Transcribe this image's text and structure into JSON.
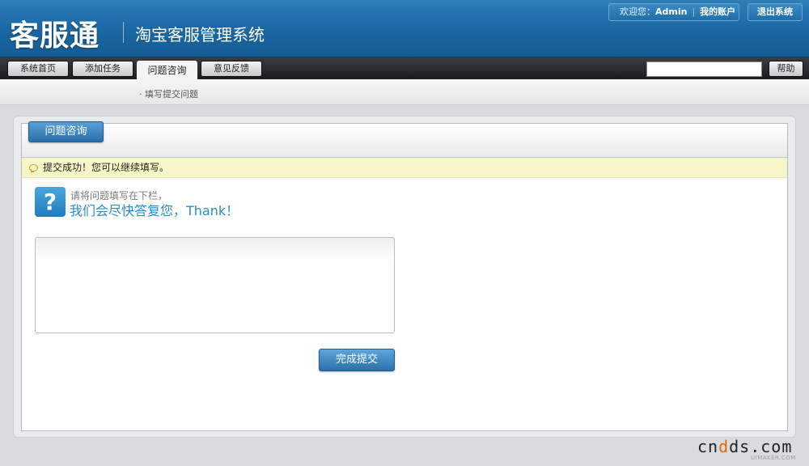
{
  "header": {
    "logo_text": "客服通",
    "system_title": "淘宝客服管理系统",
    "welcome_prefix": "欢迎您：",
    "username": "Admin",
    "separator": "|",
    "my_account": "我的账户",
    "logout": "退出系统"
  },
  "nav": {
    "tabs": [
      {
        "label": "系统首页",
        "active": false
      },
      {
        "label": "添加任务",
        "active": false
      },
      {
        "label": "问题咨询",
        "active": true
      },
      {
        "label": "意见反馈",
        "active": false
      }
    ],
    "search_value": "",
    "help_label": "帮助"
  },
  "subnav": {
    "link": "· 填写提交问题"
  },
  "panel": {
    "tab_title": "问题咨询",
    "notice": "提交成功！您可以继续填写。",
    "intro_line1": "请将问题填写在下栏，",
    "intro_line2": "我们会尽快答复您，Thank！",
    "icon_glyph": "?",
    "textarea_value": "",
    "submit_label": "完成提交"
  },
  "watermark": {
    "main_prefix": "cn",
    "main_dot": "d",
    "main_suffix": "ds.com",
    "sub": "UIMAKER.COM"
  },
  "colors": {
    "header_blue": "#1c6aa6",
    "accent_blue": "#2a8ccd",
    "notice_bg": "#f7f6c9",
    "nav_dark": "#1b1c1e"
  }
}
